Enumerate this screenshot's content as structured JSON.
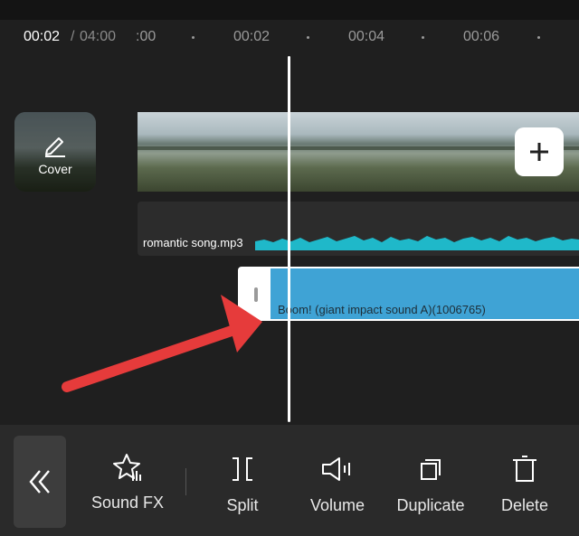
{
  "timeline": {
    "current_time": "00:02",
    "separator": "/",
    "total_time": "04:00",
    "ticks": [
      ":00",
      "00:02",
      "00:04",
      "00:06"
    ]
  },
  "cover": {
    "label": "Cover",
    "icon": "pencil-icon"
  },
  "tracks": {
    "audio": {
      "label": "romantic song.mp3",
      "color": "#1fb8c9"
    },
    "sound_fx": {
      "label": "Boom! (giant impact sound A)(1006765)",
      "color": "#3fa3d5"
    }
  },
  "toolbar": {
    "back_icon": "double-chevron-left-icon",
    "items": [
      {
        "label": "Sound FX",
        "icon": "star-sound-icon"
      },
      {
        "label": "Split",
        "icon": "split-icon"
      },
      {
        "label": "Volume",
        "icon": "speaker-icon"
      },
      {
        "label": "Duplicate",
        "icon": "duplicate-icon"
      },
      {
        "label": "Delete",
        "icon": "trash-icon"
      }
    ]
  },
  "colors": {
    "annotation_arrow": "#e63b3b",
    "background": "#1f1f1f"
  }
}
